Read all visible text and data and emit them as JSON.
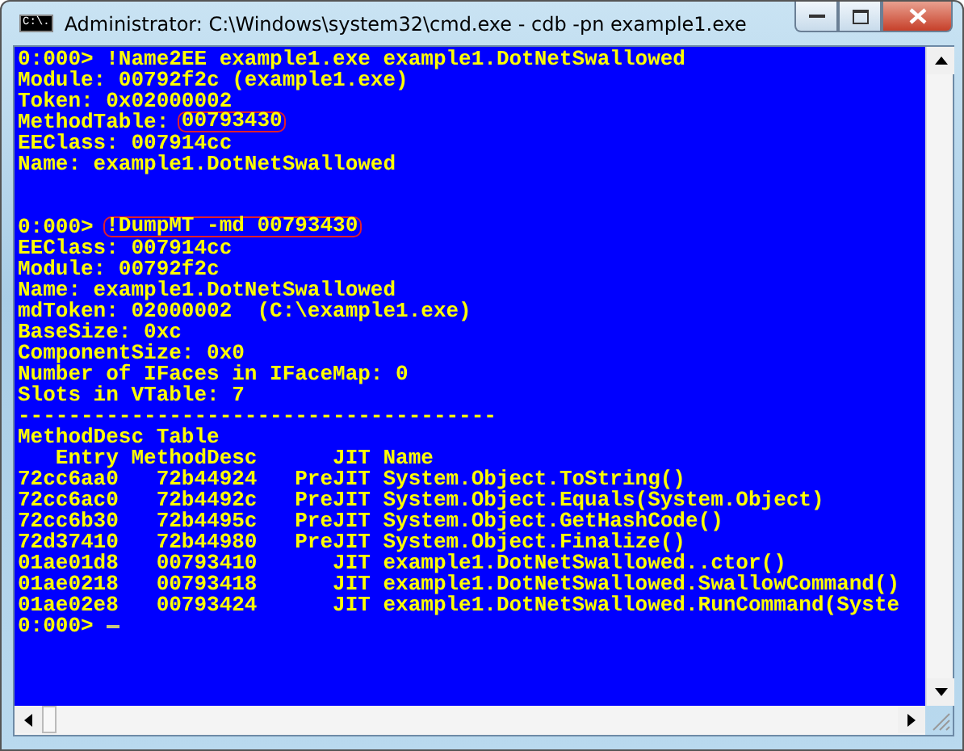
{
  "window": {
    "title": "Administrator: C:\\Windows\\system32\\cmd.exe - cdb  -pn example1.exe",
    "icon_text": "C:\\."
  },
  "console": {
    "lines": [
      {
        "kind": "text",
        "parts": [
          {
            "text": "0:000> !Name2EE example1.exe example1.DotNetSwallowed",
            "circled": false
          }
        ]
      },
      {
        "kind": "text",
        "parts": [
          {
            "text": "Module: 00792f2c (example1.exe)",
            "circled": false
          }
        ]
      },
      {
        "kind": "text",
        "parts": [
          {
            "text": "Token: 0x02000002",
            "circled": false
          }
        ]
      },
      {
        "kind": "text",
        "parts": [
          {
            "text": "MethodTable: ",
            "circled": false
          },
          {
            "text": "00793430",
            "circled": true
          }
        ]
      },
      {
        "kind": "text",
        "parts": [
          {
            "text": "EEClass: 007914cc",
            "circled": false
          }
        ]
      },
      {
        "kind": "text",
        "parts": [
          {
            "text": "Name: example1.DotNetSwallowed",
            "circled": false
          }
        ]
      },
      {
        "kind": "blank"
      },
      {
        "kind": "blank"
      },
      {
        "kind": "text",
        "parts": [
          {
            "text": "0:000> ",
            "circled": false
          },
          {
            "text": "!DumpMT -md 00793430",
            "circled": true
          }
        ]
      },
      {
        "kind": "text",
        "parts": [
          {
            "text": "EEClass: 007914cc",
            "circled": false
          }
        ]
      },
      {
        "kind": "text",
        "parts": [
          {
            "text": "Module: 00792f2c",
            "circled": false
          }
        ]
      },
      {
        "kind": "text",
        "parts": [
          {
            "text": "Name: example1.DotNetSwallowed",
            "circled": false
          }
        ]
      },
      {
        "kind": "text",
        "parts": [
          {
            "text": "mdToken: 02000002  (C:\\example1.exe)",
            "circled": false
          }
        ]
      },
      {
        "kind": "text",
        "parts": [
          {
            "text": "BaseSize: 0xc",
            "circled": false
          }
        ]
      },
      {
        "kind": "text",
        "parts": [
          {
            "text": "ComponentSize: 0x0",
            "circled": false
          }
        ]
      },
      {
        "kind": "text",
        "parts": [
          {
            "text": "Number of IFaces in IFaceMap: 0",
            "circled": false
          }
        ]
      },
      {
        "kind": "text",
        "parts": [
          {
            "text": "Slots in VTable: 7",
            "circled": false
          }
        ]
      },
      {
        "kind": "text",
        "parts": [
          {
            "text": "--------------------------------------",
            "circled": false
          }
        ]
      },
      {
        "kind": "text",
        "parts": [
          {
            "text": "MethodDesc Table",
            "circled": false
          }
        ]
      },
      {
        "kind": "text",
        "parts": [
          {
            "text": "   Entry MethodDesc      JIT Name",
            "circled": false
          }
        ]
      },
      {
        "kind": "text",
        "parts": [
          {
            "text": "72cc6aa0   72b44924   PreJIT System.Object.ToString()",
            "circled": false
          }
        ]
      },
      {
        "kind": "text",
        "parts": [
          {
            "text": "72cc6ac0   72b4492c   PreJIT System.Object.Equals(System.Object)",
            "circled": false
          }
        ]
      },
      {
        "kind": "text",
        "parts": [
          {
            "text": "72cc6b30   72b4495c   PreJIT System.Object.GetHashCode()",
            "circled": false
          }
        ]
      },
      {
        "kind": "text",
        "parts": [
          {
            "text": "72d37410   72b44980   PreJIT System.Object.Finalize()",
            "circled": false
          }
        ]
      },
      {
        "kind": "text",
        "parts": [
          {
            "text": "01ae01d8   00793410      JIT example1.DotNetSwallowed..ctor()",
            "circled": false
          }
        ]
      },
      {
        "kind": "text",
        "parts": [
          {
            "text": "01ae0218   00793418      JIT example1.DotNetSwallowed.SwallowCommand()",
            "circled": false
          }
        ]
      },
      {
        "kind": "text",
        "parts": [
          {
            "text": "01ae02e8   00793424      JIT example1.DotNetSwallowed.RunCommand(Syste",
            "circled": false
          }
        ]
      },
      {
        "kind": "prompt",
        "text": "0:000>"
      }
    ]
  }
}
